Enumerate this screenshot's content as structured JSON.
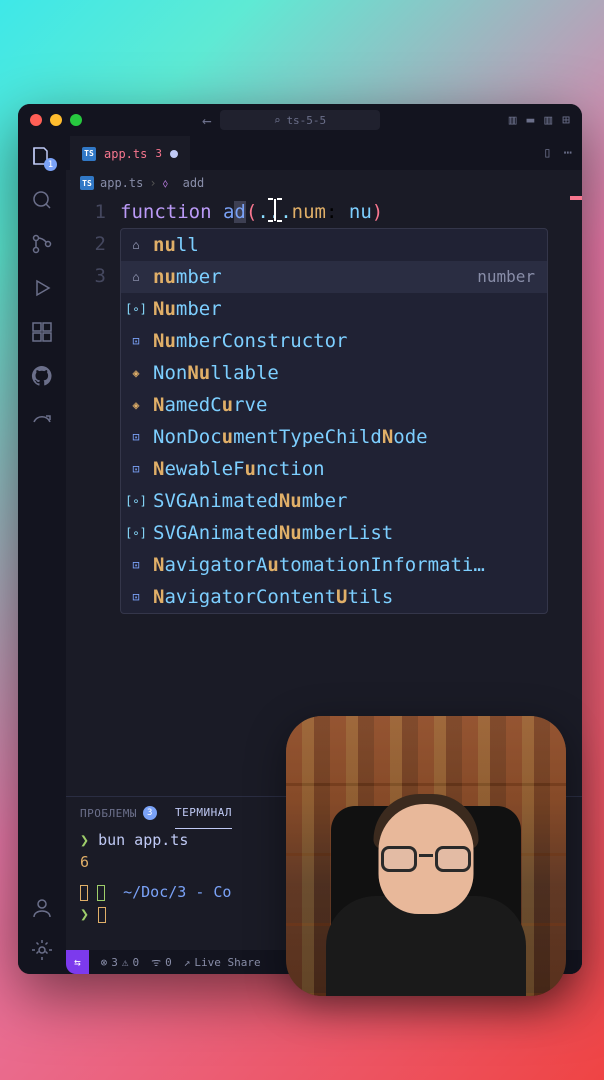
{
  "window": {
    "search_placeholder": "ts-5-5"
  },
  "activity": {
    "explorer_badge": "1"
  },
  "tab": {
    "filename": "app.ts",
    "error_count": "3"
  },
  "breadcrumb": {
    "file": "app.ts",
    "symbol": "add"
  },
  "editor": {
    "lines": [
      "1",
      "2",
      "3"
    ],
    "tokens": {
      "keyword": "function",
      "fname": "a",
      "fname2": "d",
      "rest": "...",
      "param": "num",
      "colon": ": ",
      "typed": "nu"
    }
  },
  "autocomplete": {
    "hint": "number",
    "items": [
      {
        "kind": "keyword",
        "pre": "",
        "hl": "nu",
        "post": "ll"
      },
      {
        "kind": "keyword",
        "pre": "",
        "hl": "nu",
        "post": "mber",
        "selected": true
      },
      {
        "kind": "variable",
        "pre": "",
        "hl": "Nu",
        "post": "mber"
      },
      {
        "kind": "interface",
        "pre": "",
        "hl": "Nu",
        "post": "mberConstructor"
      },
      {
        "kind": "class",
        "pre": "Non",
        "hl": "Nu",
        "post": "llable"
      },
      {
        "kind": "class",
        "pre": "",
        "hl": "N",
        "post": "amedC",
        "hl2": "u",
        "post2": "rve"
      },
      {
        "kind": "interface",
        "pre": "NonDoc",
        "hl": "u",
        "post": "mentTypeChild",
        "hl2": "N",
        "post2": "ode"
      },
      {
        "kind": "interface",
        "pre": "",
        "hl": "N",
        "post": "ewableF",
        "hl2": "u",
        "post2": "nction"
      },
      {
        "kind": "variable",
        "pre": "SVGAnimated",
        "hl": "Nu",
        "post": "mber"
      },
      {
        "kind": "variable",
        "pre": "SVGAnimated",
        "hl": "Nu",
        "post": "mberList"
      },
      {
        "kind": "interface",
        "pre": "",
        "hl": "N",
        "post": "avigatorA",
        "hl2": "u",
        "post2": "tomationInformati…"
      },
      {
        "kind": "interface",
        "pre": "",
        "hl": "N",
        "post": "avigatorContent",
        "hl2": "U",
        "post2": "tils"
      }
    ]
  },
  "panel": {
    "tabs": {
      "problems": "ПРОБЛЕМЫ",
      "problems_count": "3",
      "terminal": "ТЕРМИНАЛ"
    },
    "terminal": {
      "cmd": "bun app.ts",
      "out": "6",
      "path": "~/Doc/3 - Co"
    }
  },
  "status": {
    "remote": "⇆",
    "errors": "3",
    "warnings": "0",
    "ports": "0",
    "liveshare": "Live Share"
  }
}
